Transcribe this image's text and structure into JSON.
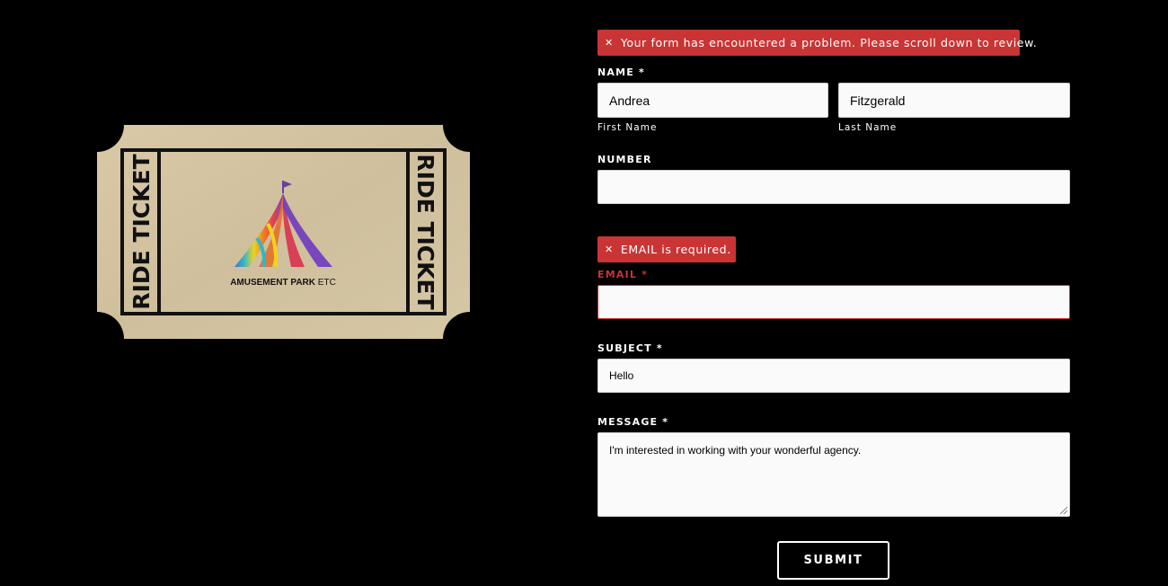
{
  "ticket": {
    "side_text": "RIDE TICKET",
    "brand_main": "AMUSEMENT PARK",
    "brand_suffix": "ETC"
  },
  "form": {
    "top_alert": "Your form has encountered a problem. Please scroll down to review.",
    "name_label": "NAME *",
    "first_name_value": "Andrea",
    "last_name_value": "Fitzgerald",
    "first_name_sublabel": "First Name",
    "last_name_sublabel": "Last Name",
    "number_label": "NUMBER",
    "number_value": "",
    "email_alert": "EMAIL is required.",
    "email_label": "EMAIL *",
    "email_value": "",
    "subject_label": "SUBJECT *",
    "subject_value": "Hello",
    "message_label": "MESSAGE *",
    "message_value": "I'm interested in working with your wonderful agency.",
    "submit_label": "SUBMIT"
  },
  "colors": {
    "background": "#000000",
    "error": "#c83534",
    "ticket_paper": "#d8c8a6",
    "field_bg": "#fafafa"
  }
}
